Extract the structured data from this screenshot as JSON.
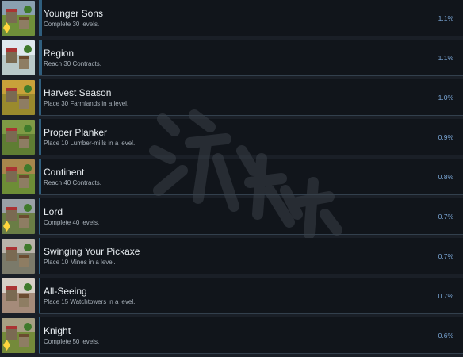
{
  "achievements": [
    {
      "title": "Younger Sons",
      "description": "Complete 30 levels.",
      "percent": "1.1%",
      "progress": 0.011,
      "thumb": {
        "sky": "#8aa0b0",
        "ground": "#6f8f3a"
      },
      "badge": true
    },
    {
      "title": "Region",
      "description": "Reach 30 Contracts.",
      "percent": "1.1%",
      "progress": 0.011,
      "thumb": {
        "sky": "#dfe8ee",
        "ground": "#b9c9c9"
      },
      "badge": false
    },
    {
      "title": "Harvest Season",
      "description": "Place 30 Farmlands in a level.",
      "percent": "1.0%",
      "progress": 0.01,
      "thumb": {
        "sky": "#c8a13a",
        "ground": "#9a8a2d"
      },
      "badge": false
    },
    {
      "title": "Proper Planker",
      "description": "Place 10 Lumber-mills in a level.",
      "percent": "0.9%",
      "progress": 0.009,
      "thumb": {
        "sky": "#7f9a45",
        "ground": "#5f7d33"
      },
      "badge": false
    },
    {
      "title": "Continent",
      "description": "Reach 40 Contracts.",
      "percent": "0.8%",
      "progress": 0.008,
      "thumb": {
        "sky": "#a8864c",
        "ground": "#6d8d36"
      },
      "badge": false
    },
    {
      "title": "Lord",
      "description": "Complete 40 levels.",
      "percent": "0.7%",
      "progress": 0.007,
      "thumb": {
        "sky": "#9aa0a6",
        "ground": "#6a7d45"
      },
      "badge": true
    },
    {
      "title": "Swinging Your Pickaxe",
      "description": "Place 10 Mines in a level.",
      "percent": "0.7%",
      "progress": 0.007,
      "thumb": {
        "sky": "#b9b3aa",
        "ground": "#7b7a6a"
      },
      "badge": false
    },
    {
      "title": "All-Seeing",
      "description": "Place 15 Watchtowers in a level.",
      "percent": "0.7%",
      "progress": 0.007,
      "thumb": {
        "sky": "#d7cfc6",
        "ground": "#a58b7a"
      },
      "badge": false
    },
    {
      "title": "Knight",
      "description": "Complete 50 levels.",
      "percent": "0.6%",
      "progress": 0.006,
      "thumb": {
        "sky": "#a79f83",
        "ground": "#748a3a"
      },
      "badge": true
    }
  ],
  "watermark_color": "#3a4048"
}
